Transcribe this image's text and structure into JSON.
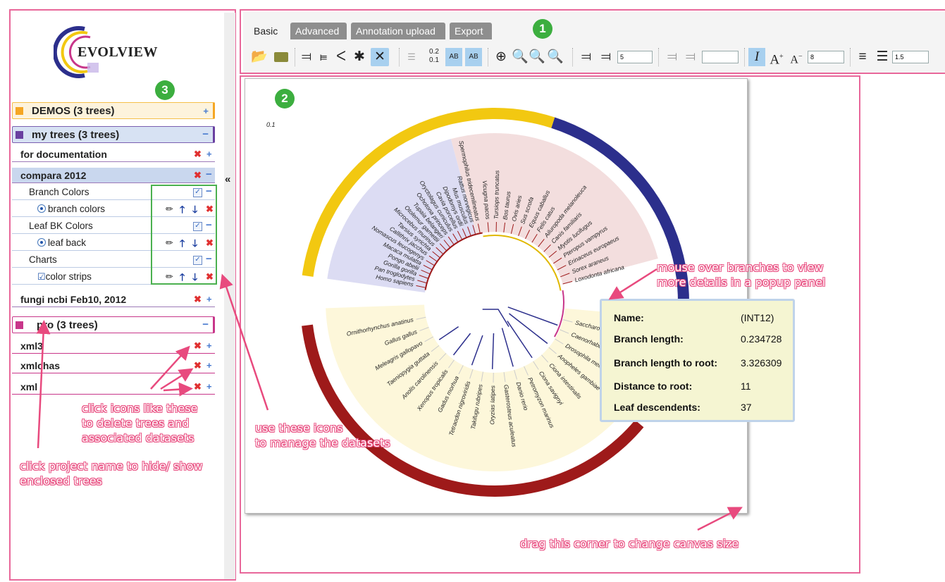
{
  "logo": {
    "text": "EVOLVIEW"
  },
  "markers": {
    "toolbar": "1",
    "canvas": "2",
    "sidebar": "3"
  },
  "sidebar": {
    "collapse_glyph": "«",
    "projects": [
      {
        "label": "DEMOS (3 trees)",
        "color": "#f5a623",
        "toggle": "+"
      },
      {
        "label": "my trees (3 trees)",
        "color": "#6a3fa0",
        "toggle": "−"
      },
      {
        "label": "pro (3 trees)",
        "color": "#c8368a",
        "toggle": "−"
      }
    ],
    "my_trees": [
      {
        "label": "for documentation"
      },
      {
        "label": "compara 2012"
      },
      {
        "label": "fungi ncbi Feb10, 2012"
      }
    ],
    "datasets": [
      {
        "group": "Branch Colors",
        "item": "branch colors"
      },
      {
        "group": "Leaf BK Colors",
        "item": "leaf back"
      },
      {
        "group": "Charts",
        "item": "color strips"
      }
    ],
    "pro_trees": [
      {
        "label": "xml3"
      },
      {
        "label": "xmlchas"
      },
      {
        "label": "xml"
      }
    ]
  },
  "toolbar": {
    "tabs": [
      "Basic",
      "Advanced",
      "Annotation upload",
      "Export"
    ],
    "inputs": {
      "leaf_space": "5",
      "font_size": "8",
      "line_width": "1.5"
    }
  },
  "canvas": {
    "scale_label": "0.1",
    "colors": {
      "blue_range": "#dcdcf3",
      "pink_range": "#f3dede",
      "yellow_range": "#fdf7da",
      "yellow_strip": "#f2c811",
      "navy_strip": "#2c2f8c",
      "red_strip": "#9e1a1a"
    }
  },
  "popup": {
    "rows": [
      {
        "label": "Name:",
        "value": "(INT12)"
      },
      {
        "label": "Branch length:",
        "value": "0.234728"
      },
      {
        "label": "Branch length to root:",
        "value": "3.326309"
      },
      {
        "label": "Distance to root:",
        "value": "11"
      },
      {
        "label": "Leaf descendents:",
        "value": "37"
      }
    ]
  },
  "annotations": {
    "mouse_over": [
      "mouse over branches to view",
      "more details in a popup panel"
    ],
    "delete": [
      "click icons like these",
      "to delete trees and",
      "associated datasets"
    ],
    "manage": [
      "use these icons",
      "to manage the datasets"
    ],
    "project": [
      "click project name to hide/ show",
      "enclosed trees"
    ],
    "drag": [
      "drag this corner to change canvas size"
    ]
  },
  "species_left": [
    "Homo sapiens",
    "Pan troglodytes",
    "Gorilla gorilla",
    "Pongo abelii",
    "Macaca mulatta",
    "Nomascus leucogenys",
    "Callithrix jacchus",
    "Tarsius syrichta",
    "Microcebus murinus",
    "Otolemur garnettii",
    "Tupaia belangeri",
    "Ochotona princeps",
    "Oryctolagus cuniculus",
    "Cavia porcellus",
    "Dipodomys ordii",
    "Mus musculus",
    "Rattus norvegicus",
    "Spermophilus tridecemlineatus"
  ],
  "species_right": [
    "Vicugna pacos",
    "Tursiops truncatus",
    "Bos taurus",
    "Ovis aries",
    "Sus scrofa",
    "Equus caballus",
    "Felis catus",
    "Ailuropoda melanoleuca",
    "Canis familiaris",
    "Myotis lucifugus",
    "Pteropus vampyrus",
    "Erinaceus europaeus",
    "Sorex araneus",
    "Loxodonta africana"
  ],
  "species_bottom": [
    "Saccharomyces cerevisiae",
    "Caenorhabditis elegans",
    "Drosophila melanogaster",
    "Anopheles gambiae",
    "Ciona intestinalis",
    "Ciona savignyi",
    "Petromyzon marinus",
    "Danio rerio",
    "Gasterosteus aculeatus",
    "Oryzias latipes",
    "Takifugu rubripes",
    "Tetraodon nigroviridis",
    "Gadus morhua",
    "Xenopus tropicalis",
    "Anolis carolinensis",
    "Taeniopygia guttata",
    "Meleagris gallopavo",
    "Gallus gallus",
    "Ornithorhynchus anatinus"
  ]
}
